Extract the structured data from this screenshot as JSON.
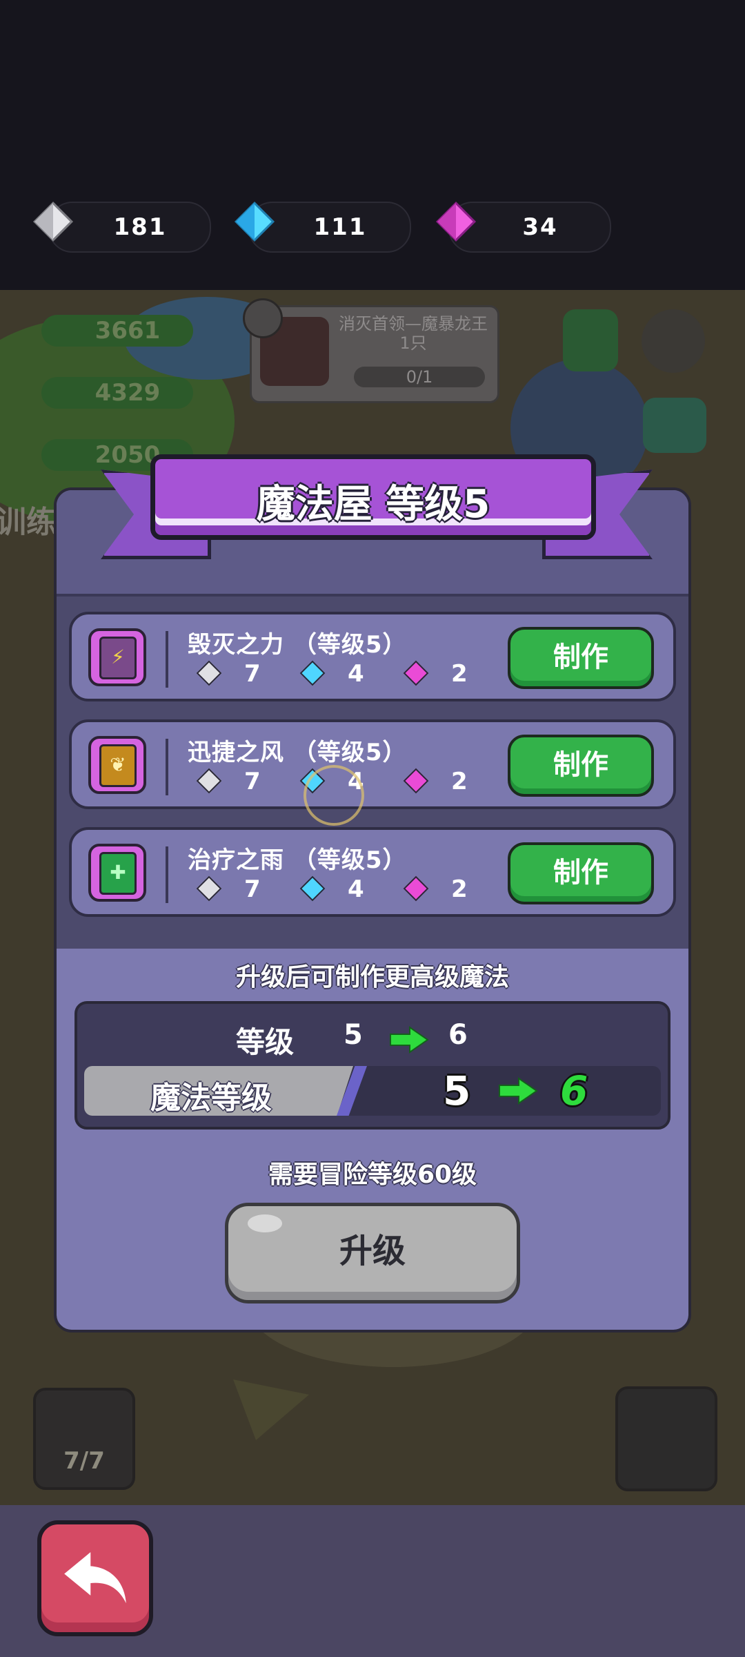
{
  "currencies": [
    {
      "name": "silver-gem",
      "value": "181",
      "color": "#d9d9de"
    },
    {
      "name": "blue-gem",
      "value": "111",
      "color": "#4fd6ff"
    },
    {
      "name": "pink-gem",
      "value": "34",
      "color": "#ea4bd6"
    }
  ],
  "background": {
    "resources": [
      "3661",
      "4329",
      "2050"
    ],
    "boss_task": {
      "text": "消灭首领—魔暴龙王1只",
      "progress": "0/1"
    },
    "side_label": "训练",
    "slime_count": "7/7"
  },
  "dialog": {
    "title": "魔法屋 等级5",
    "spells": [
      {
        "name": "毁灭之力 （等级5）",
        "costs": [
          "7",
          "4",
          "2"
        ],
        "craft_label": "制作",
        "book_color": "#7a4a8a",
        "book_icon": "⚡"
      },
      {
        "name": "迅捷之风 （等级5）",
        "costs": [
          "7",
          "4",
          "2"
        ],
        "craft_label": "制作",
        "book_color": "#c48a1e",
        "book_icon": "❦"
      },
      {
        "name": "治疗之雨 （等级5）",
        "costs": [
          "7",
          "4",
          "2"
        ],
        "craft_label": "制作",
        "book_color": "#27a24a",
        "book_icon": "✚"
      }
    ],
    "upgrade_hint": "升级后可制作更高级魔法",
    "level": {
      "label": "等级",
      "from": "5",
      "to": "6"
    },
    "magic_level": {
      "label": "魔法等级",
      "from": "5",
      "to": "6"
    },
    "requirement": "需要冒险等级60级",
    "upgrade_label": "升级"
  }
}
